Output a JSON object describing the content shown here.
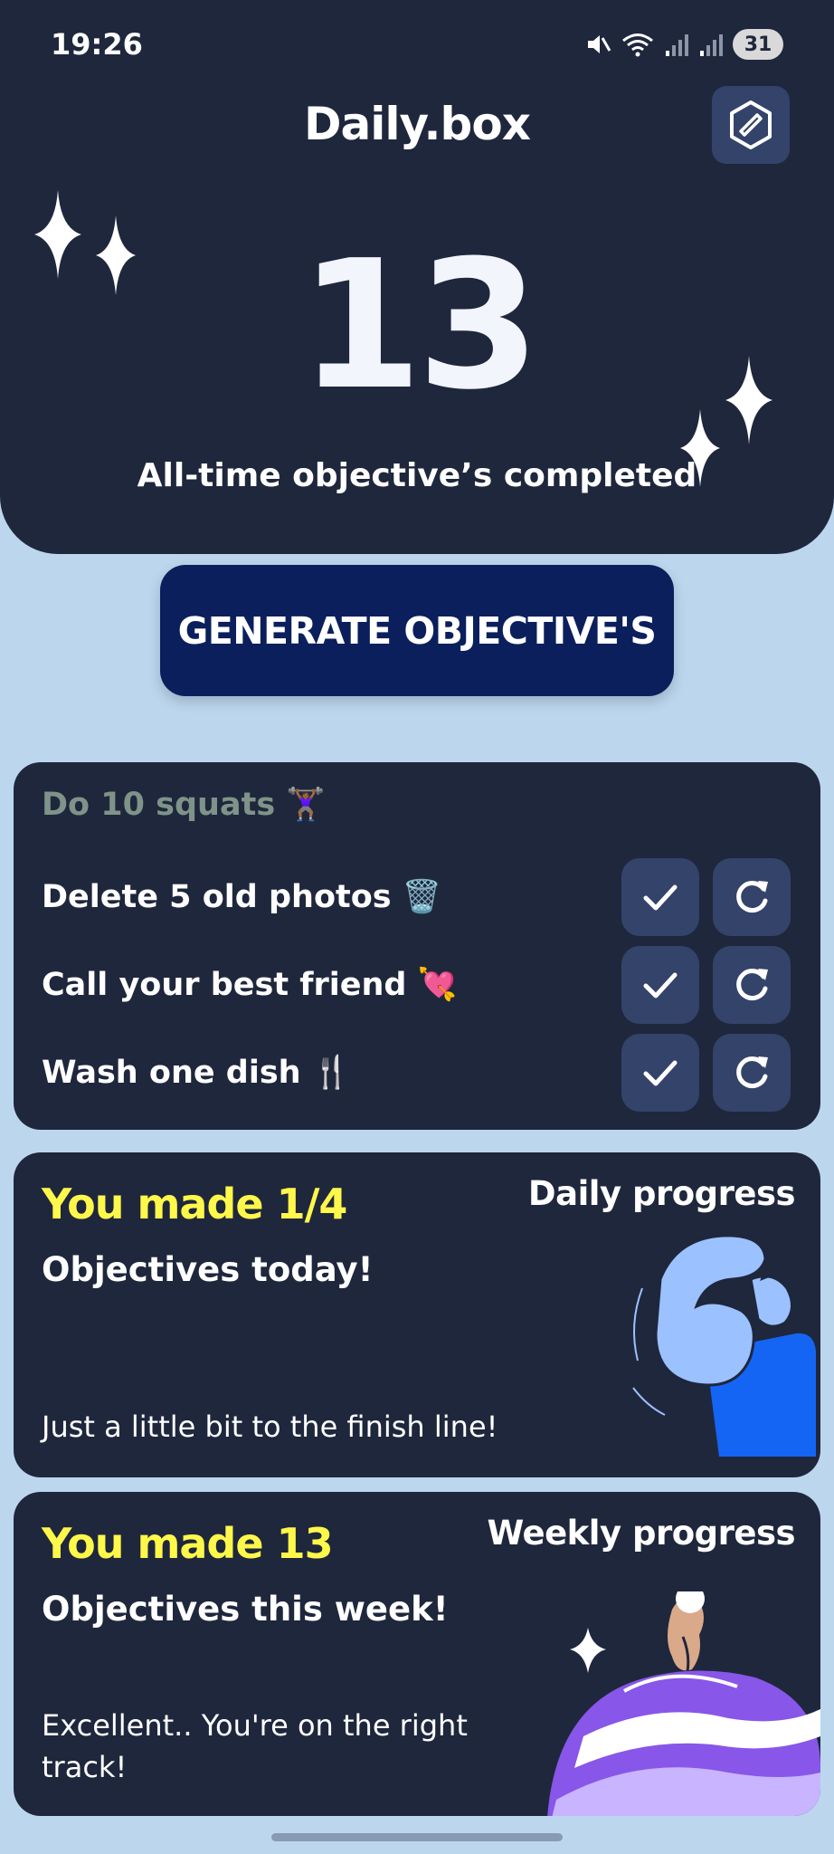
{
  "status": {
    "time": "19:26",
    "battery": "31"
  },
  "app": {
    "title": "Daily.box"
  },
  "stats": {
    "all_time_count": "13",
    "all_time_caption": "All-time objective’s completed"
  },
  "actions": {
    "generate_label": "GENERATE OBJECTIVE'S"
  },
  "objectives": {
    "completed": [
      {
        "text": "Do 10 squats 🏋🏾‍♀️"
      }
    ],
    "pending": [
      {
        "text": "Delete 5 old photos 🗑️"
      },
      {
        "text": "Call your best friend 💘"
      },
      {
        "text": "Wash one dish 🍴"
      }
    ]
  },
  "daily": {
    "title": "Daily progress",
    "made": "You made 1/4",
    "subhead": "Objectives today!",
    "note": "Just a little bit to the finish line!"
  },
  "weekly": {
    "title": "Weekly progress",
    "made": "You made 13",
    "subhead": "Objectives this week!",
    "note": "Excellent.. You're on the right track!"
  },
  "icons": {
    "settings": "compass-icon",
    "check": "checkmark-icon",
    "regenerate": "refresh-icon",
    "sparkle": "sparkle-icon"
  },
  "colors": {
    "panel": "#1f273d",
    "background": "#bcd6ee",
    "button_primary": "#0b1f5c",
    "icon_button": "#34436a",
    "highlight": "#fff84a",
    "completed_text": "#7f9389"
  }
}
